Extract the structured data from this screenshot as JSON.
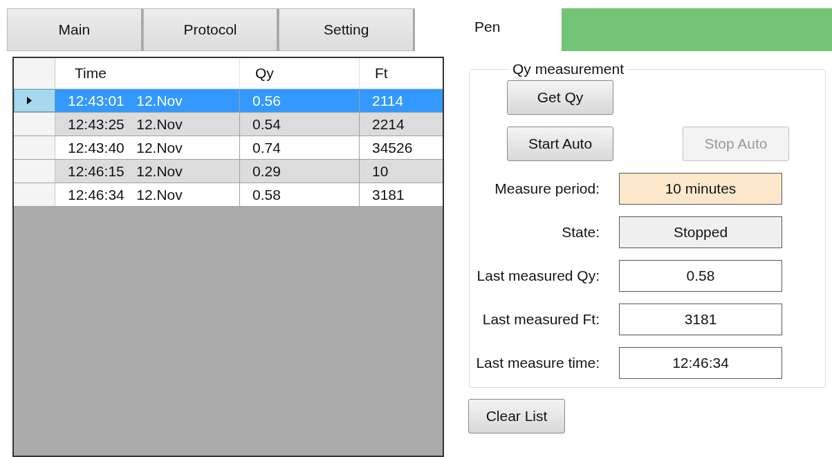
{
  "tab_buttons": [
    "Main",
    "Protocol",
    "Setting"
  ],
  "table": {
    "columns": [
      "Time",
      "Qy",
      "Ft"
    ],
    "rows": [
      {
        "selected": true,
        "cells": [
          "12:43:01   12.Nov",
          "0.56",
          "2114"
        ]
      },
      {
        "selected": false,
        "cells": [
          "12:43:25   12.Nov",
          "0.54",
          "2214"
        ]
      },
      {
        "selected": false,
        "cells": [
          "12:43:40   12.Nov",
          "0.74",
          "34526"
        ]
      },
      {
        "selected": false,
        "cells": [
          "12:46:15   12.Nov",
          "0.29",
          "10"
        ]
      },
      {
        "selected": false,
        "cells": [
          "12:46:34   12.Nov",
          "0.58",
          "3181"
        ]
      }
    ]
  },
  "pen": {
    "label": "Pen"
  },
  "group": {
    "title": "Qy measurement",
    "button_rows": [
      [
        {
          "label": "Get Qy",
          "disabled": false
        }
      ],
      [
        {
          "label": "Start Auto",
          "disabled": false
        },
        {
          "label": "Stop Auto",
          "disabled": true
        }
      ]
    ],
    "fields": [
      {
        "kind": "highlight",
        "label": "Measure period:",
        "value": "10 minutes"
      },
      {
        "kind": "readonly",
        "label": "State:",
        "value": "Stopped"
      },
      {
        "kind": "plain",
        "label": "Last measured Qy:",
        "value": "0.58"
      },
      {
        "kind": "plain",
        "label": "Last measured Ft:",
        "value": "3181"
      },
      {
        "kind": "plain",
        "label": "Last measure time:",
        "value": "12:46:34"
      }
    ]
  },
  "clear_button": "Clear List"
}
